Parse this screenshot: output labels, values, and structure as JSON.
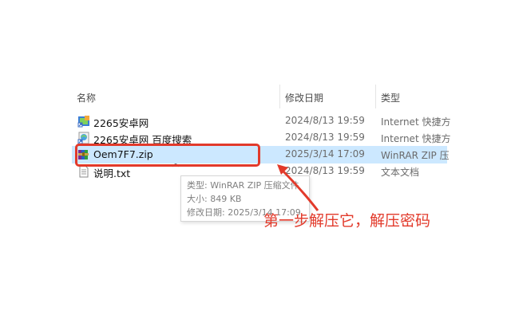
{
  "columns": {
    "name": "名称",
    "date": "修改日期",
    "type": "类型"
  },
  "files": [
    {
      "name": "2265安卓网",
      "date": "2024/8/13 19:59",
      "type": "Internet 快捷方",
      "icon": "internet-shortcut-icon"
    },
    {
      "name": "2265安卓网 百度搜索",
      "date": "2024/8/13 19:59",
      "type": "Internet 快捷方",
      "icon": "internet-shortcut-icon"
    },
    {
      "name": "Oem7F7.zip",
      "date": "2025/3/14 17:09",
      "type": "WinRAR ZIP 压",
      "icon": "winrar-archive-icon",
      "selected": true
    },
    {
      "name": "说明.txt",
      "date": "2024/8/13 19:59",
      "type": "文本文档",
      "icon": "text-document-icon"
    }
  ],
  "tooltip": {
    "type_line": "类型: WinRAR ZIP 压缩文件",
    "size_line": "大小: 849 KB",
    "modified_line": "修改日期: 2025/3/14 17:09"
  },
  "annotation": {
    "text": "第一步解压它，解压密码",
    "color": "#e23a2b"
  },
  "colors": {
    "selected_row": "#cce8ff",
    "header_text": "#4c4c4c"
  }
}
